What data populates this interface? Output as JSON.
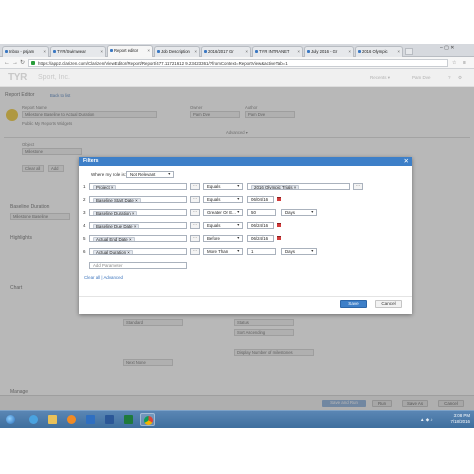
{
  "browser": {
    "tabs": [
      {
        "label": "Inbox - psjam"
      },
      {
        "label": "TYR/Swimwear"
      },
      {
        "label": "Report editor"
      },
      {
        "label": "Job Description"
      },
      {
        "label": "2016/2017 Gr"
      },
      {
        "label": "TYR INTRANET"
      },
      {
        "label": "July 2016 - Gr"
      },
      {
        "label": "2016 Olympic"
      }
    ],
    "url": "https://app2.clarizen.com/Clarizen/ViewEditor/Report/Report/477.11721612 9.23423361/?fromContext=ReportView&activeTab=1",
    "nav": {
      "back": "←",
      "forward": "→",
      "reload": "↻"
    }
  },
  "app": {
    "logo": "TYR",
    "company": "Sport, Inc.",
    "header_right": {
      "search": "Recents ▾",
      "user": "Pam Dve"
    }
  },
  "background": {
    "report_editor": "Report Editor",
    "back_to_list": "Back to list",
    "title_label": "Report Name",
    "title_value": "Milestone Baseline to Actual Duration",
    "sub_label": "Public  My Reports  Widgets",
    "owner_label": "Owner",
    "owner_value": "Pam Dve",
    "author_label": "Author",
    "author_value": "Pam Dve",
    "advanced": "Advanced ▾",
    "object_label": "Object",
    "object_value": "Milestone",
    "chips": [
      "Clear all",
      "Add"
    ],
    "section_baseline": "Baseline Duration",
    "baseline_value": "Milestone Baseline",
    "section_highlights": "Highlights",
    "section_chart": "Chart",
    "section_manage": "Manage",
    "chart_fields": [
      "Standard",
      "Status",
      "Sort Ascending",
      "Display Number of milestones",
      "Next None"
    ],
    "bottom_buttons": {
      "save_and_run": "Save and Run",
      "run": "Run",
      "save_as": "Save As",
      "cancel": "Cancel"
    }
  },
  "modal": {
    "title": "Filters",
    "role_label": "Where my role is:",
    "role_value": "Not Relevant",
    "rows": [
      {
        "num": "1",
        "field": "Project",
        "operator": "Equals",
        "value": "2016 Olympic Trials",
        "has_date": false,
        "unit": ""
      },
      {
        "num": "2",
        "field": "Baseline Start Date",
        "operator": "Equals",
        "value": "06/04/16",
        "has_date": true,
        "unit": ""
      },
      {
        "num": "3",
        "field": "Baseline Duration",
        "operator": "Greater Or E...",
        "value": "50",
        "has_date": false,
        "unit": "Days"
      },
      {
        "num": "4",
        "field": "Baseline Due Date",
        "operator": "Equals",
        "value": "06/24/16",
        "has_date": true,
        "unit": ""
      },
      {
        "num": "5",
        "field": "Actual End Date",
        "operator": "Before",
        "value": "06/24/16",
        "has_date": true,
        "unit": ""
      },
      {
        "num": "6",
        "field": "Actual Duration",
        "operator": "More Than",
        "value": "1",
        "has_date": false,
        "unit": "Days"
      }
    ],
    "add_parameter": "Add Parameter",
    "clear_all": "Clear all",
    "advanced": "Advanced",
    "save": "Save",
    "cancel": "Cancel"
  },
  "taskbar": {
    "time": "3:08 PM",
    "date": "7/18/2016"
  }
}
